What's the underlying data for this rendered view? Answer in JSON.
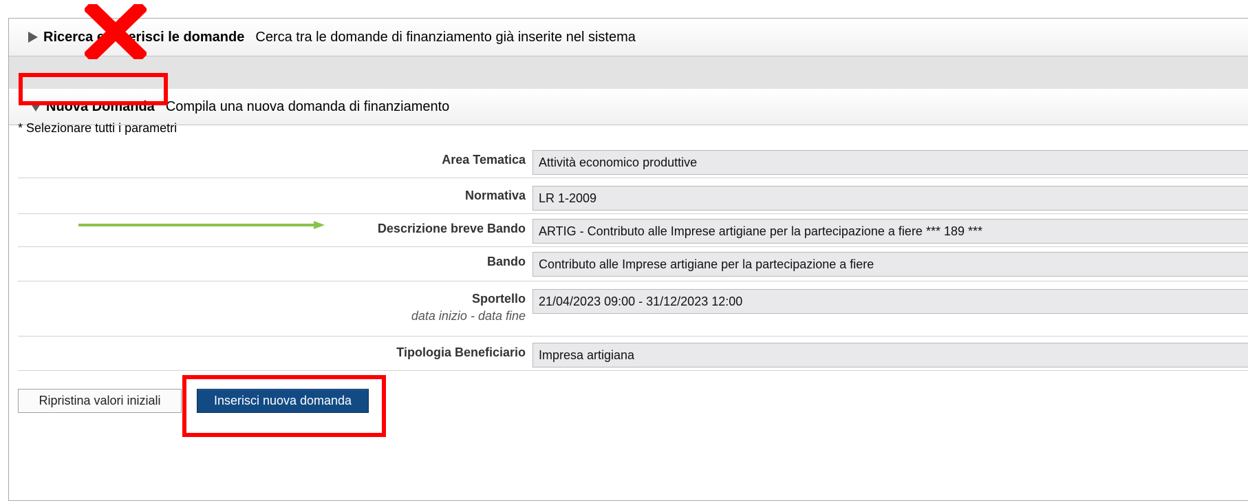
{
  "ricerca": {
    "title": "Ricerca e inserisci le domande",
    "description": "Cerca tra le domande di finanziamento già inserite nel sistema"
  },
  "nuova": {
    "title": "Nuova Domanda",
    "description": "Compila una nuova domanda di finanziamento"
  },
  "form": {
    "required_note": "* Selezionare tutti i parametri",
    "fields": [
      {
        "label": "Area Tematica",
        "value": "Attività economico produttive"
      },
      {
        "label": "Normativa",
        "value": "LR 1-2009"
      },
      {
        "label": "Descrizione breve Bando",
        "value": "ARTIG - Contributo alle Imprese artigiane per la partecipazione a fiere *** 189 ***"
      },
      {
        "label": "Bando",
        "value": "Contributo alle Imprese artigiane per la partecipazione a fiere"
      },
      {
        "label": "Sportello",
        "sublabel": "data inizio - data fine",
        "value": "21/04/2023 09:00 - 31/12/2023 12:00"
      },
      {
        "label": "Tipologia Beneficiario",
        "value": "Impresa artigiana"
      }
    ]
  },
  "buttons": {
    "reset_label": "Ripristina valori iniziali",
    "insert_label": "Inserisci nuova domanda"
  },
  "colors": {
    "highlight": "#ff0000",
    "arrow": "#8bc34a",
    "primary_button": "#124a84"
  },
  "icons": {
    "collapsed": "triangle-right-icon",
    "expanded": "triangle-down-icon",
    "cross": "red-x-icon",
    "pointer": "green-arrow-icon"
  }
}
